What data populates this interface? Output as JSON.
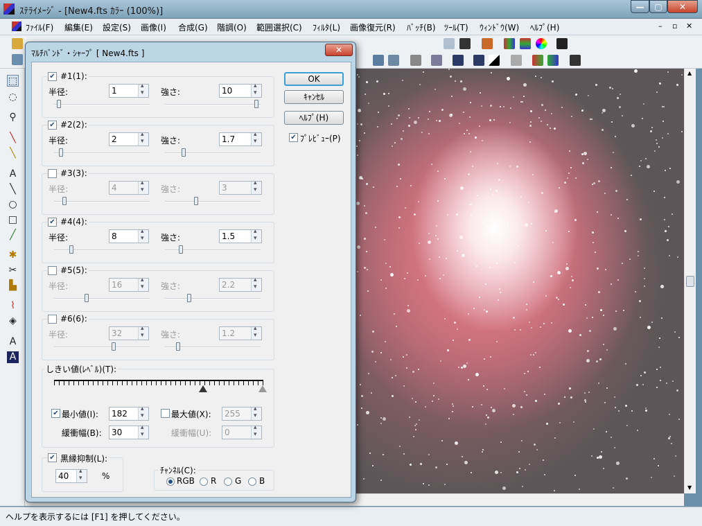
{
  "window": {
    "title": "ｽﾃﾗｲﾒｰｼﾞ - [New4.fts ｶﾗｰ (100%)]",
    "minimize": "—",
    "maximize": "▢",
    "close": "✕"
  },
  "menu": [
    "ﾌｧｲﾙ(F)",
    "編集(E)",
    "設定(S)",
    "画像(I)",
    "合成(G)",
    "階調(O)",
    "範囲選択(C)",
    "ﾌｨﾙﾀ(L)",
    "画像復元(R)",
    "ﾊﾞｯﾁ(B)",
    "ﾂｰﾙ(T)",
    "ｳｨﾝﾄﾞｳ(W)",
    "ﾍﾙﾌﾟ(H)"
  ],
  "status": "ヘルプを表示するには [F1] を押してください。",
  "dialog": {
    "title": "ﾏﾙﾁﾊﾞﾝﾄﾞ・ｼｬｰﾌﾟ [ New4.fts ]",
    "close": "✕",
    "ok": "OK",
    "cancel": "ｷｬﾝｾﾙ",
    "help": "ﾍﾙﾌﾟ(H)",
    "preview": "ﾌﾟﾚﾋﾞｭｰ(P)",
    "radius_label": "半径:",
    "strength_label": "強さ:",
    "bands": [
      {
        "label": "#1(1):",
        "checked": true,
        "radius": "1",
        "strength": "10",
        "r_pos": 0.03,
        "s_pos": 0.98
      },
      {
        "label": "#2(2):",
        "checked": true,
        "radius": "2",
        "strength": "1.7",
        "r_pos": 0.05,
        "s_pos": 0.18
      },
      {
        "label": "#3(3):",
        "checked": false,
        "radius": "4",
        "strength": "3",
        "r_pos": 0.09,
        "s_pos": 0.32
      },
      {
        "label": "#4(4):",
        "checked": true,
        "radius": "8",
        "strength": "1.5",
        "r_pos": 0.17,
        "s_pos": 0.15
      },
      {
        "label": "#5(5):",
        "checked": false,
        "radius": "16",
        "strength": "2.2",
        "r_pos": 0.33,
        "s_pos": 0.24
      },
      {
        "label": "#6(6):",
        "checked": false,
        "radius": "32",
        "strength": "1.2",
        "r_pos": 0.63,
        "s_pos": 0.12
      }
    ],
    "threshold_label": "しきい値(ﾚﾍﾞﾙ)(T):",
    "min_label": "最小値(I):",
    "min_value": "182",
    "min_buffer_label": "緩衝幅(B):",
    "min_buffer": "30",
    "max_label": "最大値(X):",
    "max_value": "255",
    "max_buffer_label": "緩衝幅(U):",
    "max_buffer": "0",
    "edge_label": "黒縁抑制(L):",
    "edge_value": "40",
    "edge_unit": "%",
    "channel_label": "ﾁｬﾝﾈﾙ(C):",
    "channels": [
      "RGB",
      "R",
      "G",
      "B"
    ],
    "channel_selected": "RGB"
  },
  "colors": {
    "titlebar": "#9bbad0",
    "dialog_frame": "#bcd6e6",
    "nebula": "#e58a97"
  }
}
